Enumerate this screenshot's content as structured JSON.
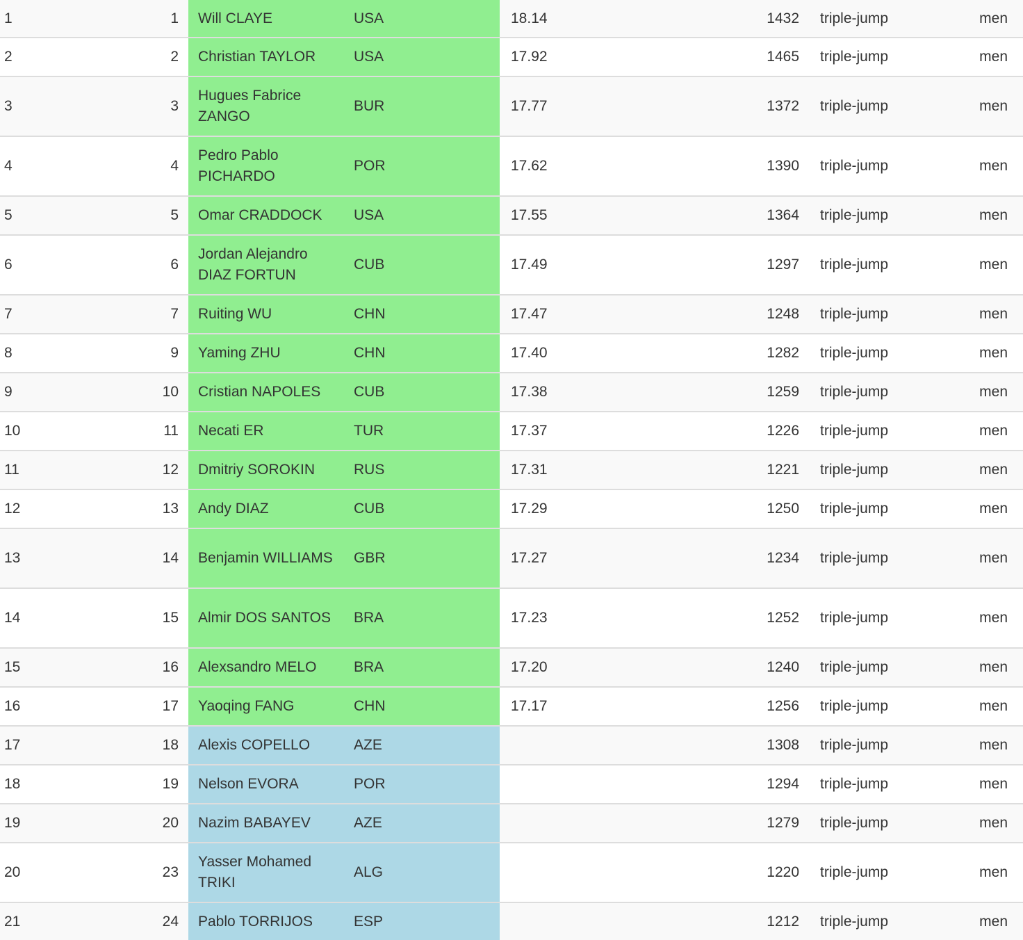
{
  "table": {
    "colors": {
      "qualified": "#90ee90",
      "non_qualified": "#add8e6",
      "row_stripe": "#f9f9f9",
      "row_plain": "#ffffff",
      "border": "#dddddd"
    },
    "rows": [
      {
        "pos": "1",
        "world_rank": "1",
        "name": "Will CLAYE",
        "country": "USA",
        "mark": "18.14",
        "score": "1432",
        "event": "triple-jump",
        "sex": "men",
        "status": "qualified"
      },
      {
        "pos": "2",
        "world_rank": "2",
        "name": "Christian TAYLOR",
        "country": "USA",
        "mark": "17.92",
        "score": "1465",
        "event": "triple-jump",
        "sex": "men",
        "status": "qualified"
      },
      {
        "pos": "3",
        "world_rank": "3",
        "name": "Hugues Fabrice ZANGO",
        "country": "BUR",
        "mark": "17.77",
        "score": "1372",
        "event": "triple-jump",
        "sex": "men",
        "status": "qualified"
      },
      {
        "pos": "4",
        "world_rank": "4",
        "name": "Pedro Pablo PICHARDO",
        "country": "POR",
        "mark": "17.62",
        "score": "1390",
        "event": "triple-jump",
        "sex": "men",
        "status": "qualified"
      },
      {
        "pos": "5",
        "world_rank": "5",
        "name": "Omar CRADDOCK",
        "country": "USA",
        "mark": "17.55",
        "score": "1364",
        "event": "triple-jump",
        "sex": "men",
        "status": "qualified"
      },
      {
        "pos": "6",
        "world_rank": "6",
        "name": "Jordan Alejandro DIAZ FORTUN",
        "country": "CUB",
        "mark": "17.49",
        "score": "1297",
        "event": "triple-jump",
        "sex": "men",
        "status": "qualified"
      },
      {
        "pos": "7",
        "world_rank": "7",
        "name": "Ruiting WU",
        "country": "CHN",
        "mark": "17.47",
        "score": "1248",
        "event": "triple-jump",
        "sex": "men",
        "status": "qualified"
      },
      {
        "pos": "8",
        "world_rank": "9",
        "name": "Yaming ZHU",
        "country": "CHN",
        "mark": "17.40",
        "score": "1282",
        "event": "triple-jump",
        "sex": "men",
        "status": "qualified"
      },
      {
        "pos": "9",
        "world_rank": "10",
        "name": "Cristian NAPOLES",
        "country": "CUB",
        "mark": "17.38",
        "score": "1259",
        "event": "triple-jump",
        "sex": "men",
        "status": "qualified"
      },
      {
        "pos": "10",
        "world_rank": "11",
        "name": "Necati ER",
        "country": "TUR",
        "mark": "17.37",
        "score": "1226",
        "event": "triple-jump",
        "sex": "men",
        "status": "qualified"
      },
      {
        "pos": "11",
        "world_rank": "12",
        "name": "Dmitriy SOROKIN",
        "country": "RUS",
        "mark": "17.31",
        "score": "1221",
        "event": "triple-jump",
        "sex": "men",
        "status": "qualified"
      },
      {
        "pos": "12",
        "world_rank": "13",
        "name": "Andy DIAZ",
        "country": "CUB",
        "mark": "17.29",
        "score": "1250",
        "event": "triple-jump",
        "sex": "men",
        "status": "qualified"
      },
      {
        "pos": "13",
        "world_rank": "14",
        "name": "Benjamin WILLIAMS",
        "country": "GBR",
        "mark": "17.27",
        "score": "1234",
        "event": "triple-jump",
        "sex": "men",
        "status": "qualified"
      },
      {
        "pos": "14",
        "world_rank": "15",
        "name": "Almir DOS SANTOS",
        "country": "BRA",
        "mark": "17.23",
        "score": "1252",
        "event": "triple-jump",
        "sex": "men",
        "status": "qualified"
      },
      {
        "pos": "15",
        "world_rank": "16",
        "name": "Alexsandro MELO",
        "country": "BRA",
        "mark": "17.20",
        "score": "1240",
        "event": "triple-jump",
        "sex": "men",
        "status": "qualified"
      },
      {
        "pos": "16",
        "world_rank": "17",
        "name": "Yaoqing FANG",
        "country": "CHN",
        "mark": "17.17",
        "score": "1256",
        "event": "triple-jump",
        "sex": "men",
        "status": "qualified"
      },
      {
        "pos": "17",
        "world_rank": "18",
        "name": "Alexis COPELLO",
        "country": "AZE",
        "mark": "",
        "score": "1308",
        "event": "triple-jump",
        "sex": "men",
        "status": "non-qualified"
      },
      {
        "pos": "18",
        "world_rank": "19",
        "name": "Nelson EVORA",
        "country": "POR",
        "mark": "",
        "score": "1294",
        "event": "triple-jump",
        "sex": "men",
        "status": "non-qualified"
      },
      {
        "pos": "19",
        "world_rank": "20",
        "name": "Nazim BABAYEV",
        "country": "AZE",
        "mark": "",
        "score": "1279",
        "event": "triple-jump",
        "sex": "men",
        "status": "non-qualified"
      },
      {
        "pos": "20",
        "world_rank": "23",
        "name": "Yasser Mohamed TRIKI",
        "country": "ALG",
        "mark": "",
        "score": "1220",
        "event": "triple-jump",
        "sex": "men",
        "status": "non-qualified"
      },
      {
        "pos": "21",
        "world_rank": "24",
        "name": "Pablo TORRIJOS",
        "country": "ESP",
        "mark": "",
        "score": "1212",
        "event": "triple-jump",
        "sex": "men",
        "status": "non-qualified"
      }
    ]
  }
}
